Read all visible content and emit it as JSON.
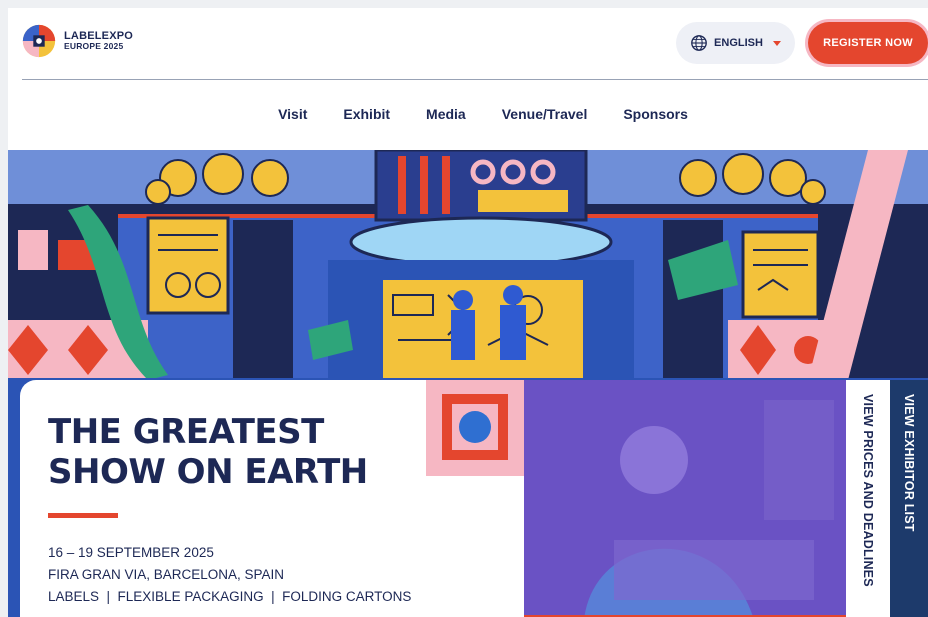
{
  "brand": {
    "line1": "LABELEXPO",
    "line2": "EUROPE 2025"
  },
  "language": {
    "label": "ENGLISH"
  },
  "header": {
    "register_label": "REGISTER NOW"
  },
  "nav": {
    "items": [
      "Visit",
      "Exhibit",
      "Media",
      "Venue/Travel",
      "Sponsors"
    ]
  },
  "hero": {
    "headline_line1": "THE GREATEST",
    "headline_line2": "SHOW ON EARTH",
    "dates": "16 – 19 SEPTEMBER 2025",
    "venue": "FIRA GRAN VIA, BARCELONA, SPAIN",
    "categories": "LABELS  |  FLEXIBLE PACKAGING  |  FOLDING CARTONS"
  },
  "side_tabs": {
    "prices": "VIEW PRICES AND DEADLINES",
    "exhibitors": "VIEW EXHIBITOR LIST"
  },
  "colors": {
    "navy": "#1d2855",
    "accent_red": "#e4462e",
    "pink": "#f6b7c3",
    "purple_tint": "#6a52c4",
    "tab_blue": "#1d3a6b"
  },
  "icons": [
    "logo-mark-icon",
    "globe-icon",
    "caret-down-icon"
  ]
}
